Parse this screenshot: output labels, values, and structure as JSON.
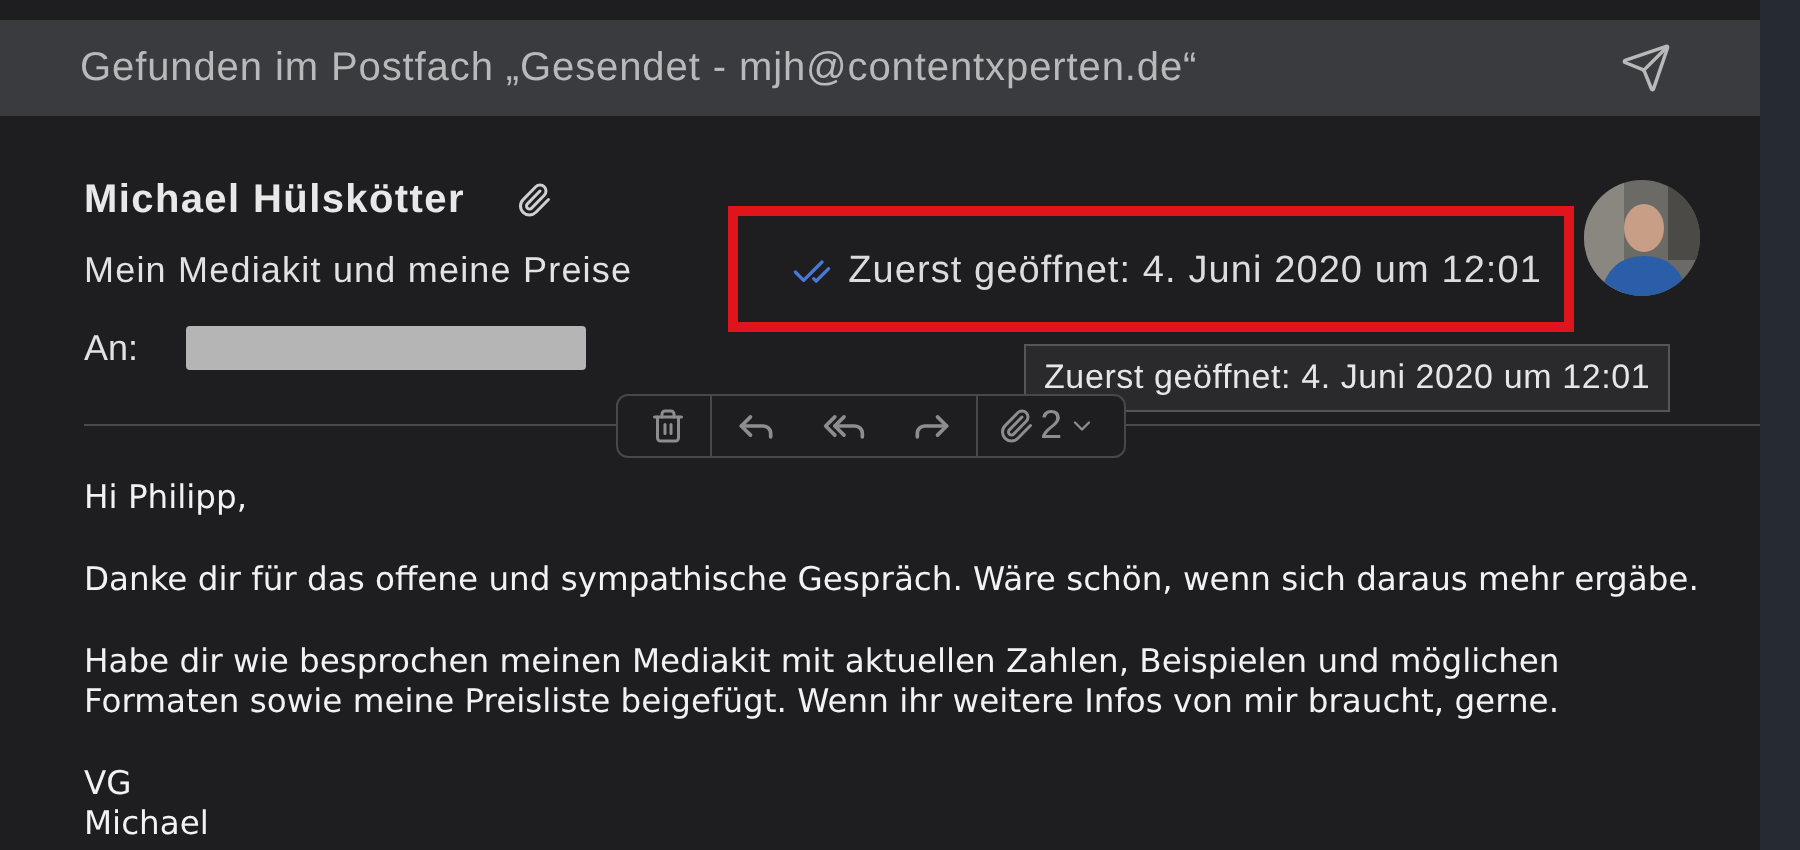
{
  "search_banner": {
    "text": "Gefunden im Postfach „Gesendet - mjh@contentxperten.de“"
  },
  "message": {
    "sender": "Michael Hülskötter",
    "has_attachment": true,
    "subject": "Mein Mediakit und meine Preise",
    "to_label": "An:",
    "first_opened": "Zuerst geöffnet: 4. Juni 2020 um 12:01",
    "read": true
  },
  "tooltip": {
    "text": "Zuerst geöffnet: 4. Juni 2020 um 12:01"
  },
  "toolbar": {
    "attachment_count": "2"
  },
  "body": [
    {
      "lines": [
        "Hi Philipp,"
      ]
    },
    {
      "lines": [
        "Danke dir für das offene und sympathische Gespräch. Wäre schön, wenn sich daraus mehr ergäbe."
      ]
    },
    {
      "lines": [
        "Habe dir wie besprochen meinen Mediakit mit aktuellen Zahlen, Beispielen und möglichen",
        "Formaten sowie meine Preisliste beigefügt. Wenn ihr weitere Infos von mir braucht, gerne."
      ]
    },
    {
      "lines": [
        "VG",
        "Michael"
      ]
    }
  ]
}
